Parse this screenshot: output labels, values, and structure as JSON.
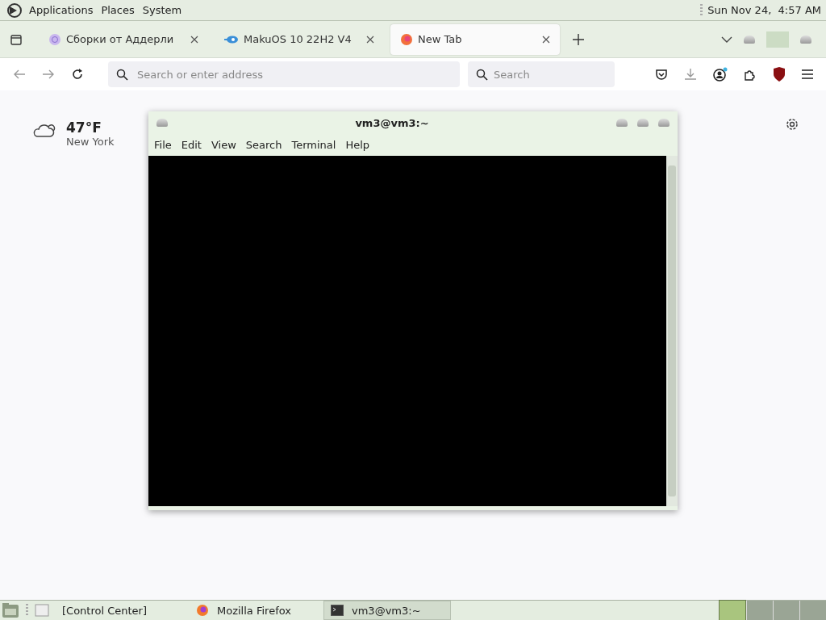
{
  "top_panel": {
    "menus": [
      "Applications",
      "Places",
      "System"
    ],
    "clock": "Sun Nov 24,  4:57 AM"
  },
  "browser": {
    "tabs": [
      {
        "title": "Сборки от Аддерли",
        "selected": false
      },
      {
        "title": "MakuOS 10 22H2 V4",
        "selected": false
      },
      {
        "title": "New Tab",
        "selected": true
      }
    ],
    "address": {
      "placeholder": "Search or enter address"
    },
    "search": {
      "placeholder": "Search"
    }
  },
  "new_tab_page": {
    "weather": {
      "temperature": "47°F",
      "city": "New York"
    }
  },
  "terminal": {
    "title": "vm3@vm3:~",
    "menus": [
      "File",
      "Edit",
      "View",
      "Search",
      "Terminal",
      "Help"
    ]
  },
  "taskbar": {
    "items": [
      {
        "label": "[Control Center]",
        "selected": false
      },
      {
        "label": "Mozilla Firefox",
        "selected": false
      },
      {
        "label": "vm3@vm3:~",
        "selected": true
      }
    ],
    "workspaces": [
      {
        "selected": true
      },
      {
        "selected": false
      },
      {
        "selected": false
      },
      {
        "selected": false
      }
    ]
  }
}
